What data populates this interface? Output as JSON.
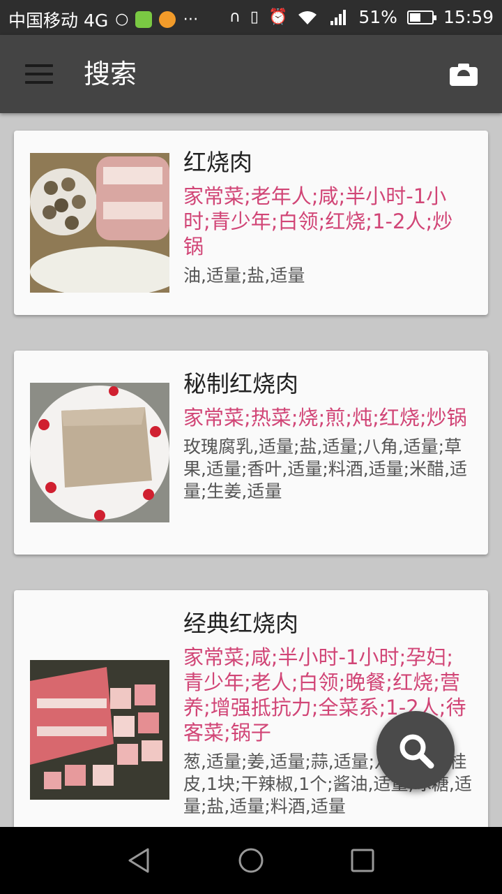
{
  "status_bar": {
    "carrier": "中国移动 4G",
    "battery_text": "51%",
    "battery_level": 0.51,
    "time": "15:59",
    "icons": [
      "chat-bubble-icon",
      "iqiyi-app-icon",
      "uc-browser-icon",
      "more-icon",
      "headset-icon",
      "vibrate-icon",
      "alarm-icon",
      "wifi-icon",
      "signal-4g-icon",
      "battery-icon"
    ]
  },
  "toolbar": {
    "title": "搜索",
    "menu_icon": "hamburger-menu-icon",
    "camera_icon": "camera-icon"
  },
  "recipes": [
    {
      "name": "红烧肉",
      "tags": "家常菜;老年人;咸;半小时-1小时;青少年;白领;红烧;1-2人;炒锅",
      "ingredients": "油,适量;盐,适量",
      "image": "eggs-pork-radish-photo"
    },
    {
      "name": "秘制红烧肉",
      "tags": "家常菜;热菜;烧;煎;炖;红烧;炒锅",
      "ingredients": "玫瑰腐乳,适量;盐,适量;八角,适量;草果,适量;香叶,适量;料酒,适量;米醋,适量;生姜,适量",
      "image": "pork-slab-on-plate-photo"
    },
    {
      "name": "经典红烧肉",
      "tags": "家常菜;咸;半小时-1小时;孕妇;青少年;老人;白领;晚餐;红烧;营养;增强抵抗力;全菜系;1-2人;待客菜;锅子",
      "ingredients": "葱,适量;姜,适量;蒜,适量;八角,2粒;桂皮,1块;干辣椒,1个;酱油,适量;冰糖,适量;盐,适量;料酒,适量",
      "image": "cut-pork-belly-photo"
    }
  ],
  "fab": {
    "icon": "search-icon"
  },
  "nav_bar": {
    "icons": [
      "back-icon",
      "home-icon",
      "recents-icon"
    ]
  },
  "colors": {
    "accent": "#d14576",
    "toolbar": "#444444",
    "background": "#c8c8c8"
  }
}
